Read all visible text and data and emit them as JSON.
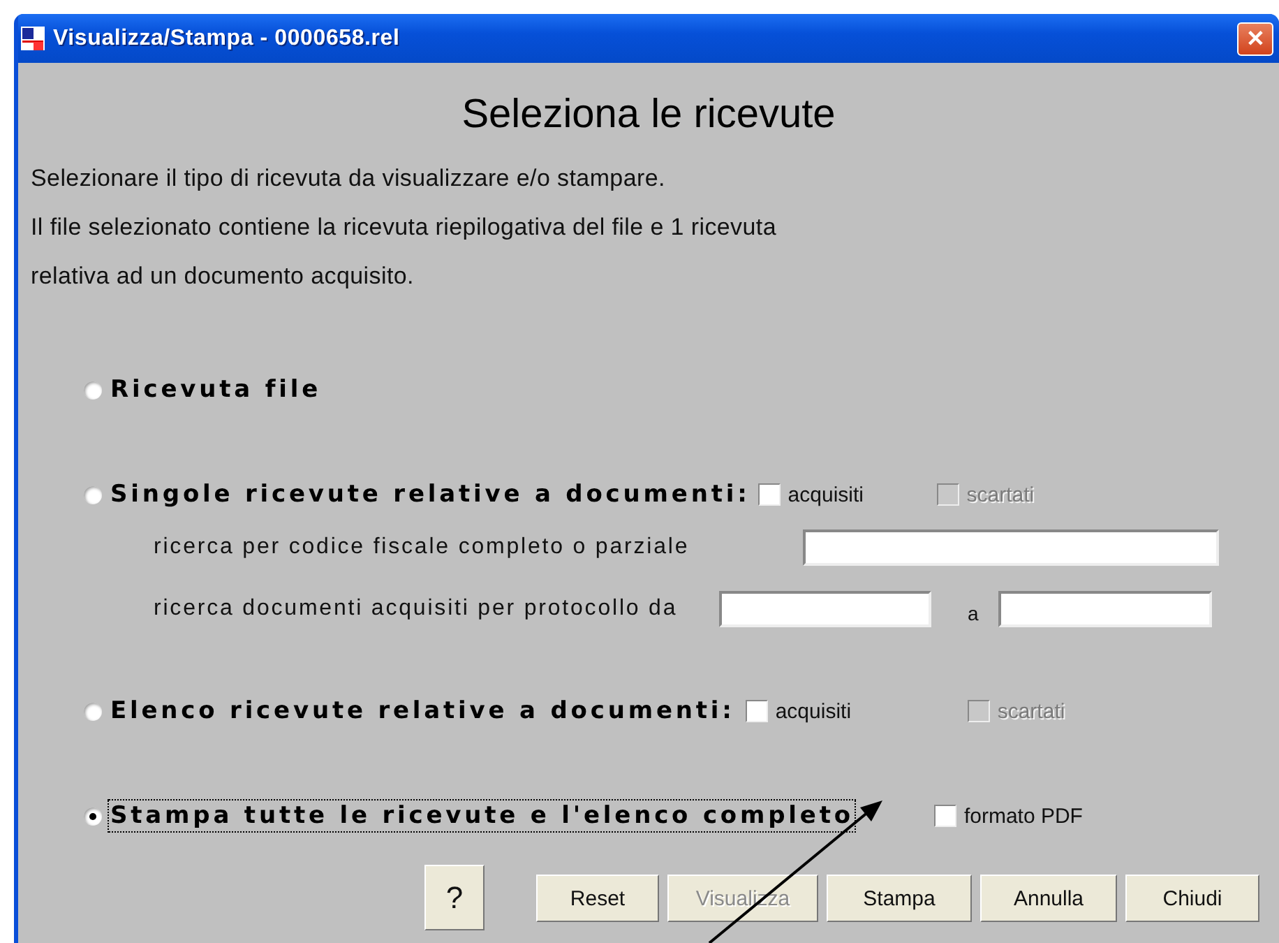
{
  "window": {
    "title": "Visualizza/Stampa - 0000658.rel",
    "close": "✕"
  },
  "heading": "Seleziona le ricevute",
  "intro": [
    "Selezionare il tipo di ricevuta da visualizzare e/o stampare.",
    "Il file selezionato contiene la ricevuta riepilogativa del file e 1 ricevuta",
    "relativa ad un documento acquisito."
  ],
  "options": [
    {
      "kind": "plain",
      "label": "Ricevuta file",
      "selected": false
    },
    {
      "kind": "search",
      "label": "Singole ricevute relative a documenti:",
      "selected": false,
      "checks": [
        {
          "label": "acquisiti",
          "checked": false,
          "disabled": false
        },
        {
          "label": "scartati",
          "checked": false,
          "disabled": true
        }
      ],
      "codice_fiscale_label": "ricerca per codice fiscale completo o parziale",
      "protocollo_label": "ricerca documenti acquisiti per protocollo  da",
      "protocollo_to": "a"
    },
    {
      "kind": "checks",
      "label": "Elenco ricevute relative a documenti:",
      "selected": false,
      "checks": [
        {
          "label": "acquisiti",
          "checked": false,
          "disabled": false
        },
        {
          "label": "scartati",
          "checked": false,
          "disabled": true
        }
      ]
    },
    {
      "kind": "pdf",
      "label": "Stampa tutte le ricevute e l'elenco completo",
      "selected": true,
      "focused": true,
      "checks": [
        {
          "label": "formato PDF",
          "checked": false,
          "disabled": false
        }
      ]
    }
  ],
  "help_button": "?",
  "buttons": [
    {
      "label": "Reset",
      "disabled": false
    },
    {
      "label": "Visualizza",
      "disabled": true
    },
    {
      "label": "Stampa",
      "disabled": false
    },
    {
      "label": "Annulla",
      "disabled": false
    },
    {
      "label": "Chiudi",
      "disabled": false
    }
  ]
}
